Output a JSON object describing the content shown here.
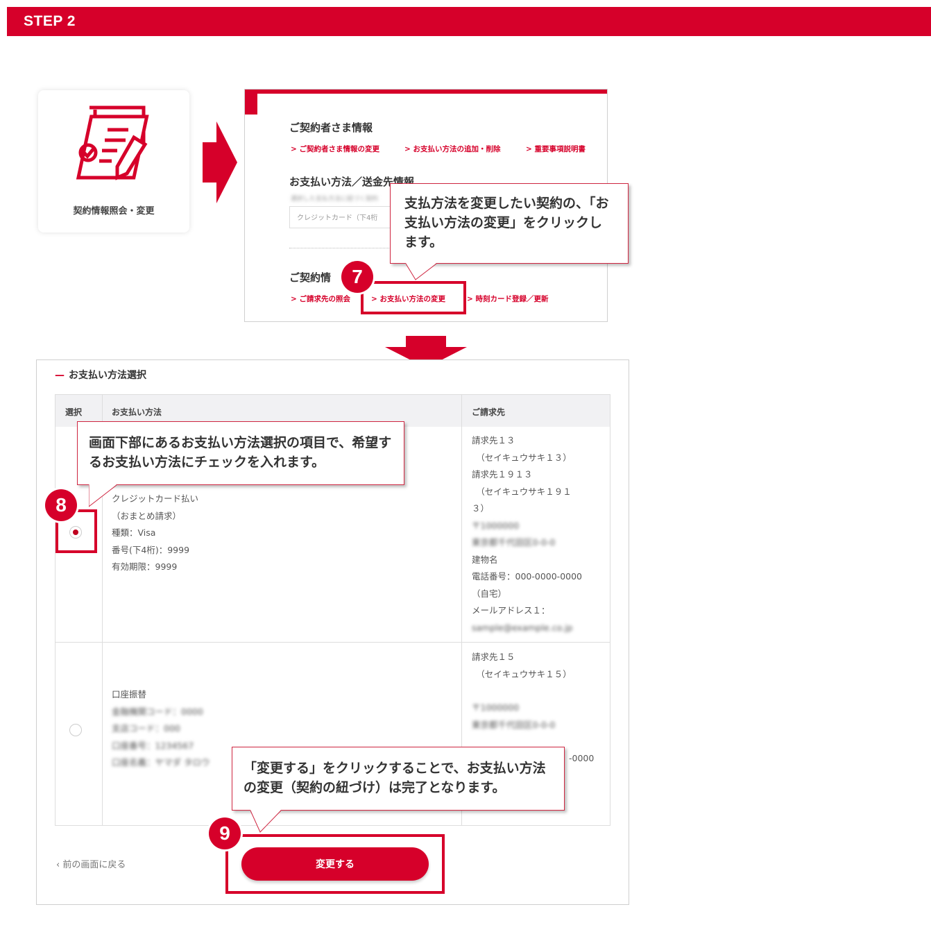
{
  "step": {
    "label": "STEP 2"
  },
  "menu_card": {
    "label": "契約情報照会・変更",
    "icon": "contract-edit-icon"
  },
  "screen1": {
    "section1_title": "ご契約者さま情報",
    "section1_links": [
      "> ご契約者さま情報の変更",
      "> お支払い方法の追加・削除",
      "> 重要事項説明書"
    ],
    "section2_title": "お支払い方法／送金先情報",
    "section2_note": "選択した支払方法に紐づく契約",
    "section2_input": "クレジットカード（下4桁",
    "section3_title": "ご契約情",
    "section3_links": [
      "> ご請求先の照会",
      "> お支払い方法の変更",
      "> 時刻カード登録／更新"
    ]
  },
  "callouts": {
    "c7": "支払方法を変更したい契約の、「お支払い方法の変更」をクリックします。",
    "c8": "画面下部にあるお支払い方法選択の項目で、希望するお支払い方法にチェックを入れます。",
    "c9": "「変更する」をクリックすることで、お支払い方法の変更（契約の紐づけ）は完了となります。"
  },
  "badges": {
    "b7": "7",
    "b8": "8",
    "b9": "9"
  },
  "screen2": {
    "section_dash": "—",
    "section_title": "お支払い方法選択",
    "headers": {
      "select": "選択",
      "method": "お支払い方法",
      "billing": "ご請求先"
    },
    "row1": {
      "selected": true,
      "method_lines": [
        "クレジットカード払い",
        "（おまとめ請求）",
        "種類：Visa",
        "番号(下4桁)：9999",
        "有効期限：9999"
      ],
      "billing_lines": [
        "請求先１３",
        "　（セイキュウサキ１３）",
        "請求先１９１３",
        "　（セイキュウサキ１９１",
        "３）",
        "〒1000000",
        "東京都千代田区0-0-0",
        "建物名",
        "電話番号：000-0000-0000",
        "（自宅）",
        "メールアドレス１：",
        "sample@example.co.jp"
      ]
    },
    "row2": {
      "selected": false,
      "method_lines": [
        "口座振替",
        "金融機関コード：0000",
        "支店コード：000",
        "口座番号：1234567",
        "口座名義：ヤマダ タロウ"
      ],
      "billing_lines": [
        "請求先１５",
        "　（セイキュウサキ１５）",
        "〒1000000",
        "東京都千代田区0-0-0",
        "-0000"
      ]
    },
    "back_label": "前の画面に戻る",
    "submit_label": "変更する"
  },
  "colors": {
    "brand_red": "#d6002a"
  }
}
